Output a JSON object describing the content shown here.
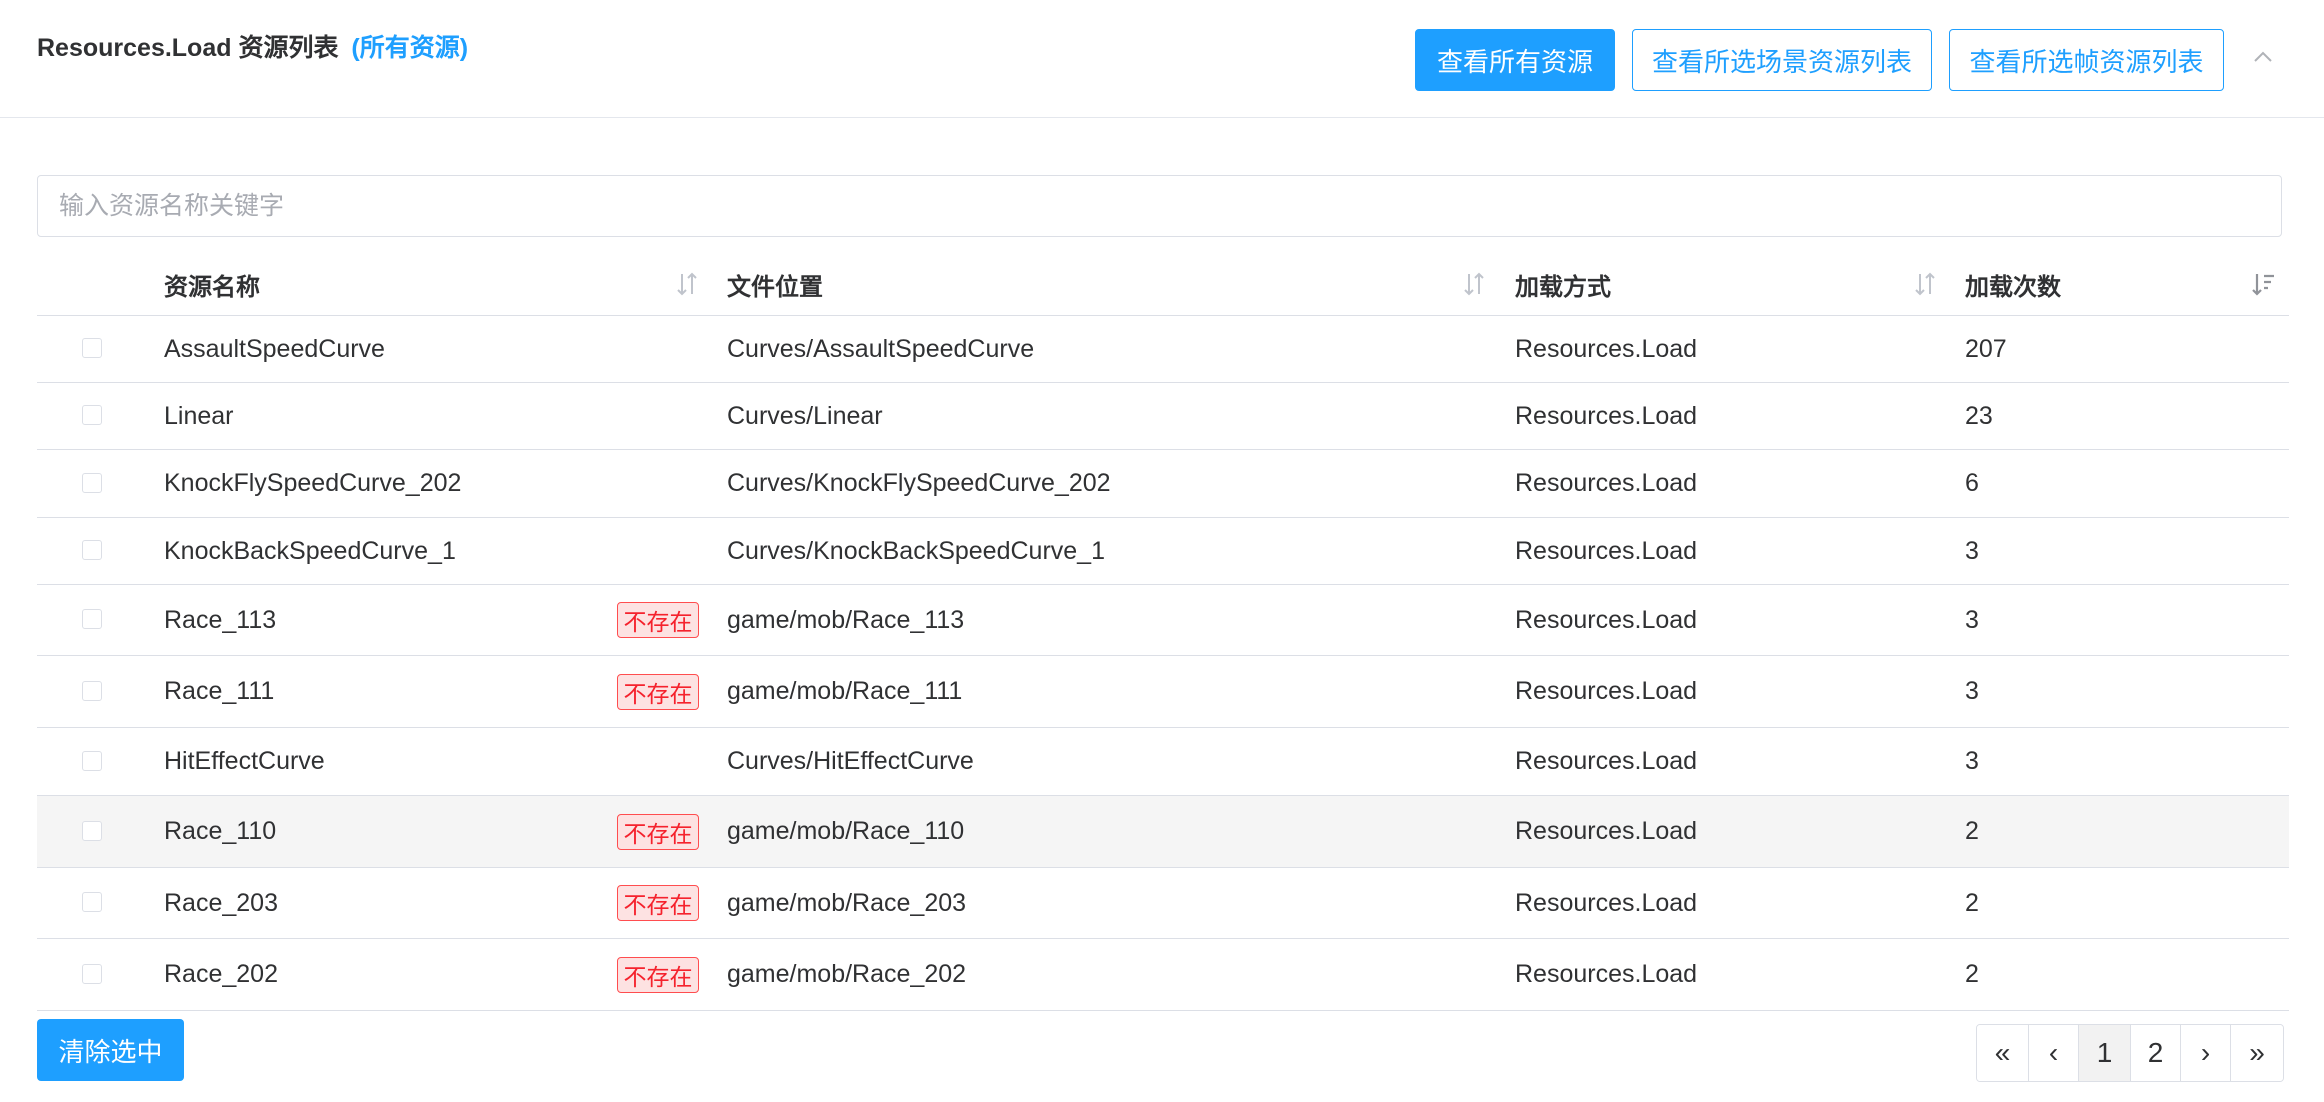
{
  "header": {
    "title": "Resources.Load 资源列表",
    "subtitle": "(所有资源)",
    "buttons": {
      "all": "查看所有资源",
      "scene": "查看所选场景资源列表",
      "frame": "查看所选帧资源列表"
    },
    "collapse_icon": "chevron-up-icon"
  },
  "search": {
    "placeholder": "输入资源名称关键字",
    "value": ""
  },
  "table": {
    "columns": [
      "资源名称",
      "文件位置",
      "加载方式",
      "加载次数"
    ],
    "active_sort": "加载次数",
    "missing_label": "不存在",
    "rows": [
      {
        "name": "AssaultSpeedCurve",
        "missing": "",
        "path": "Curves/AssaultSpeedCurve",
        "method": "Resources.Load",
        "count": "207"
      },
      {
        "name": "Linear",
        "missing": "",
        "path": "Curves/Linear",
        "method": "Resources.Load",
        "count": "23"
      },
      {
        "name": "KnockFlySpeedCurve_202",
        "missing": "",
        "path": "Curves/KnockFlySpeedCurve_202",
        "method": "Resources.Load",
        "count": "6"
      },
      {
        "name": "KnockBackSpeedCurve_1",
        "missing": "",
        "path": "Curves/KnockBackSpeedCurve_1",
        "method": "Resources.Load",
        "count": "3"
      },
      {
        "name": "Race_113",
        "missing": "不存在",
        "path": "game/mob/Race_113",
        "method": "Resources.Load",
        "count": "3"
      },
      {
        "name": "Race_111",
        "missing": "不存在",
        "path": "game/mob/Race_111",
        "method": "Resources.Load",
        "count": "3"
      },
      {
        "name": "HitEffectCurve",
        "missing": "",
        "path": "Curves/HitEffectCurve",
        "method": "Resources.Load",
        "count": "3"
      },
      {
        "name": "Race_110",
        "missing": "不存在",
        "path": "game/mob/Race_110",
        "method": "Resources.Load",
        "count": "2",
        "highlighted": true
      },
      {
        "name": "Race_203",
        "missing": "不存在",
        "path": "game/mob/Race_203",
        "method": "Resources.Load",
        "count": "2"
      },
      {
        "name": "Race_202",
        "missing": "不存在",
        "path": "game/mob/Race_202",
        "method": "Resources.Load",
        "count": "2"
      }
    ]
  },
  "footer": {
    "clear_label": "清除选中",
    "pagination": [
      "«",
      "‹",
      "1",
      "2",
      "›",
      "»"
    ],
    "current_page": "1"
  },
  "colors": {
    "accent": "#1e9fff",
    "missing_border": "#ff4d4f",
    "missing_bg": "#fde2e2",
    "row_highlight": "#f5f5f5"
  }
}
